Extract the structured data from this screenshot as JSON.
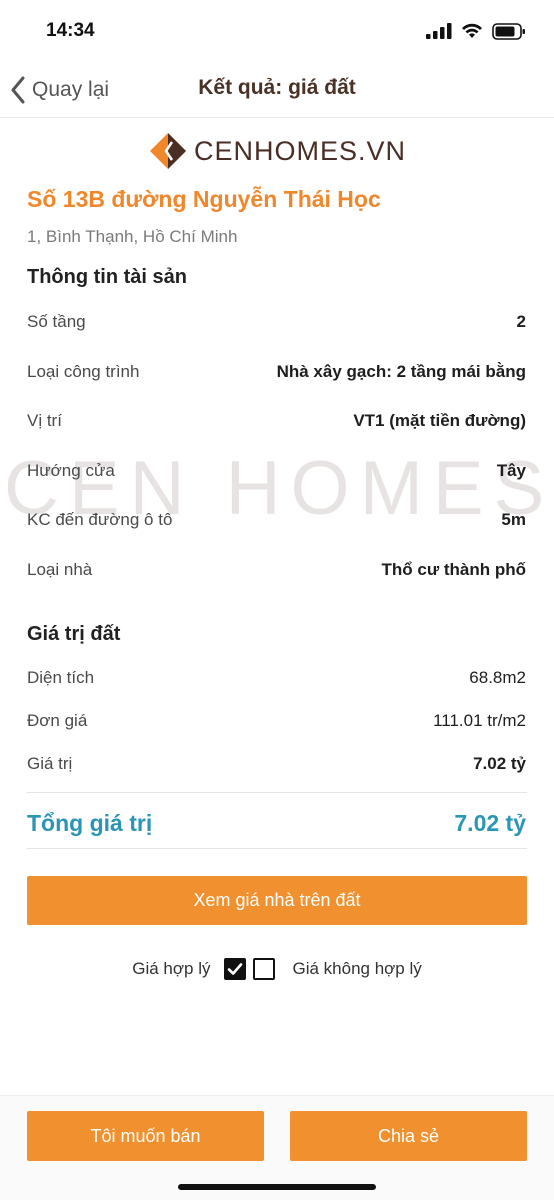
{
  "status_bar": {
    "time": "14:34"
  },
  "nav": {
    "back_label": "Quay lại",
    "title": "Kết quả: giá đất"
  },
  "logo": {
    "text": "CENHOMES.VN",
    "watermark_text": "CEN HOMES.V"
  },
  "address": {
    "title": "Số 13B đường Nguyễn Thái Học",
    "subtitle": "1, Bình Thạnh, Hồ Chí Minh"
  },
  "property_info": {
    "title": "Thông tin tài sản",
    "rows": [
      {
        "label": "Số tầng",
        "value": "2"
      },
      {
        "label": "Loại công trình",
        "value": "Nhà xây gạch: 2 tầng mái bằng"
      },
      {
        "label": "Vị trí",
        "value": "VT1 (mặt tiền đường)"
      },
      {
        "label": "Hướng cửa",
        "value": "Tây"
      },
      {
        "label": "KC đến đường ô tô",
        "value": "5m"
      },
      {
        "label": "Loại nhà",
        "value": "Thổ cư thành phố"
      }
    ]
  },
  "land_value": {
    "title": "Giá trị đất",
    "rows": [
      {
        "label": "Diện tích",
        "value": "68.8m2"
      },
      {
        "label": "Đơn giá",
        "value": "111.01 tr/m2"
      },
      {
        "label": "Giá trị",
        "value": "7.02 tỷ"
      }
    ]
  },
  "total": {
    "label": "Tổng giá trị",
    "value": "7.02 tỷ"
  },
  "cta": {
    "label": "Xem giá nhà trên đất"
  },
  "rating": {
    "reasonable_label": "Giá hợp lý",
    "reasonable_checked": true,
    "unreasonable_label": "Giá không hợp lý",
    "unreasonable_checked": false
  },
  "bottom": {
    "sell_label": "Tôi muốn bán",
    "share_label": "Chia sẻ"
  },
  "colors": {
    "accent": "#f1902e",
    "address": "#f0872a",
    "total": "#2a95b5",
    "brand_dark": "#4a2e26"
  }
}
